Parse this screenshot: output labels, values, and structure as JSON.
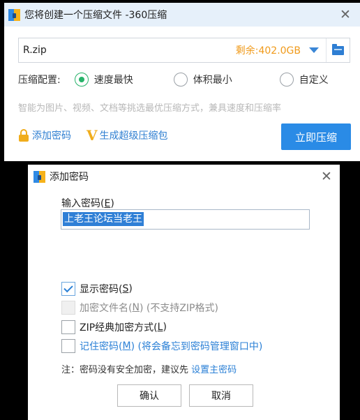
{
  "compress_window": {
    "title": "您将创建一个压缩文件 -360压缩",
    "filename": "R.zip",
    "free_space": "剩余:402.0GB",
    "config_label": "压缩配置:",
    "options": [
      "速度最快",
      "体积最小",
      "自定义"
    ],
    "selected_option": "速度最快",
    "hint": "智能为图片、视频、文档等挑选最优压缩方式，兼具速度和压缩率",
    "add_password": "添加密码",
    "make_super": "生成超级压缩包",
    "compress_button": "立即压缩",
    "colors": {
      "accent": "#2a8be6",
      "free_space": "#f09a1a",
      "selected": "#27b36a"
    }
  },
  "password_dialog": {
    "title": "添加密码",
    "input_label_prefix": "输入密码(",
    "input_label_key": "E",
    "input_label_suffix": ")",
    "password_value": "上老王论坛当老王",
    "show_password": {
      "prefix": "显示密码(",
      "key": "S",
      "suffix": ")",
      "checked": true
    },
    "encrypt_names": {
      "prefix": "加密文件名(",
      "key": "N",
      "suffix": ") (不支持ZIP格式)",
      "disabled": true
    },
    "zip_classic": {
      "prefix": "ZIP经典加密方式(",
      "key": "L",
      "suffix": ")",
      "checked": false
    },
    "remember": {
      "prefix": "记住密码(",
      "key": "M",
      "suffix": ") (将会备忘到密码管理窗口中)",
      "checked": false
    },
    "note_text": "注：密码没有安全加密，建议先 ",
    "note_link": "设置主密码",
    "ok": "确认",
    "cancel": "取消"
  }
}
